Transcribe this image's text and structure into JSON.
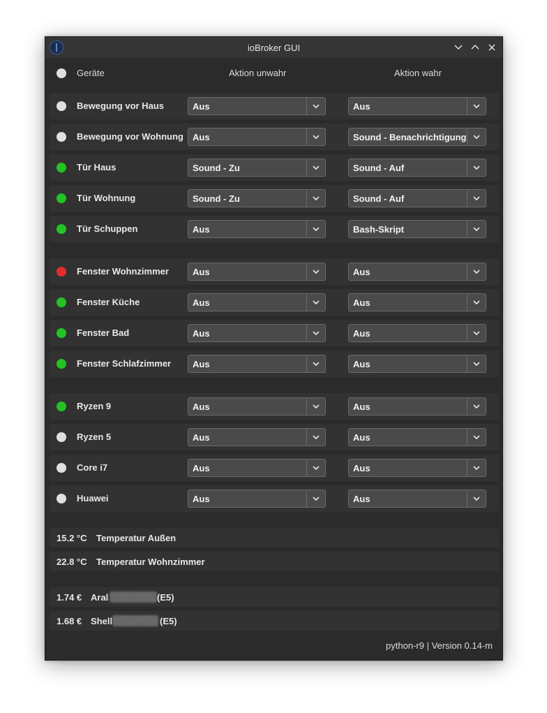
{
  "window": {
    "title": "ioBroker GUI",
    "footer": "python-r9 | Version 0.14-m"
  },
  "header": {
    "devices_label": "Geräte",
    "action_false_label": "Aktion unwahr",
    "action_true_label": "Aktion wahr",
    "status_color": "#e0e0e0"
  },
  "colors": {
    "green": "#22c322",
    "red": "#e52b2b",
    "white": "#e0e0e0"
  },
  "devices": [
    {
      "name": "Bewegung vor Haus",
      "status": "white",
      "action_false": "Aus",
      "action_true": "Aus"
    },
    {
      "name": "Bewegung vor Wohnung",
      "status": "white",
      "action_false": "Aus",
      "action_true": "Sound - Benachrichtigung"
    },
    {
      "name": "Tür Haus",
      "status": "green",
      "action_false": "Sound - Zu",
      "action_true": "Sound - Auf"
    },
    {
      "name": "Tür Wohnung",
      "status": "green",
      "action_false": "Sound - Zu",
      "action_true": "Sound - Auf"
    },
    {
      "name": "Tür Schuppen",
      "status": "green",
      "action_false": "Aus",
      "action_true": "Bash-Skript"
    },
    {
      "name": "Fenster Wohnzimmer",
      "status": "red",
      "action_false": "Aus",
      "action_true": "Aus"
    },
    {
      "name": "Fenster Küche",
      "status": "green",
      "action_false": "Aus",
      "action_true": "Aus"
    },
    {
      "name": "Fenster Bad",
      "status": "green",
      "action_false": "Aus",
      "action_true": "Aus"
    },
    {
      "name": "Fenster Schlafzimmer",
      "status": "green",
      "action_false": "Aus",
      "action_true": "Aus"
    },
    {
      "name": "Ryzen 9",
      "status": "green",
      "action_false": "Aus",
      "action_true": "Aus"
    },
    {
      "name": "Ryzen 5",
      "status": "white",
      "action_false": "Aus",
      "action_true": "Aus"
    },
    {
      "name": "Core i7",
      "status": "white",
      "action_false": "Aus",
      "action_true": "Aus"
    },
    {
      "name": "Huawei",
      "status": "white",
      "action_false": "Aus",
      "action_true": "Aus"
    }
  ],
  "temperatures": [
    {
      "value": "15.2 °C",
      "label": "Temperatur Außen"
    },
    {
      "value": "22.8 °C",
      "label": "Temperatur Wohnzimmer"
    }
  ],
  "fuel_prices": [
    {
      "price": "1.74 €",
      "station": "Aral",
      "fuel": "(E5)"
    },
    {
      "price": "1.68 €",
      "station": "Shell",
      "fuel": "(E5)"
    }
  ]
}
